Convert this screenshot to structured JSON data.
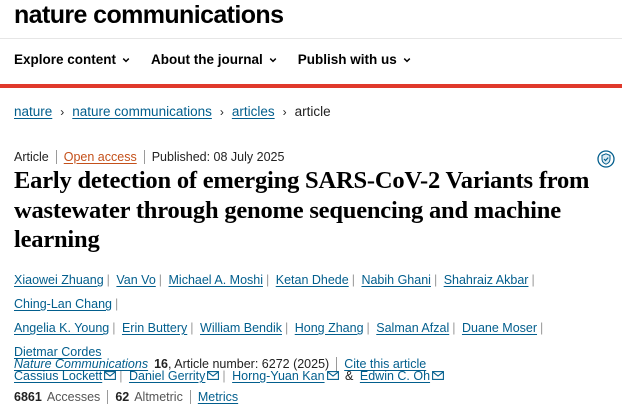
{
  "header": {
    "brand": "nature communications"
  },
  "nav": [
    {
      "label": "Explore content"
    },
    {
      "label": "About the journal"
    },
    {
      "label": "Publish with us"
    }
  ],
  "breadcrumb": {
    "items": [
      "nature",
      "nature communications",
      "articles"
    ],
    "current": "article",
    "separator": "›"
  },
  "article": {
    "type": "Article",
    "access": "Open access",
    "published": "Published: 08 July 2025",
    "title": "Early detection of emerging SARS-CoV-2 Variants from wastewater through genome sequencing and machine learning",
    "authors": [
      "Xiaowei Zhuang",
      "Van Vo",
      "Michael A. Moshi",
      "Ketan Dhede",
      "Nabih Ghani",
      "Shahraiz Akbar",
      "Ching-Lan Chang",
      "Angelia K. Young",
      "Erin Buttery",
      "William Bendik",
      "Hong Zhang",
      "Salman Afzal",
      "Duane Moser",
      "Dietmar Cordes",
      "Cassius Lockett",
      "Daniel Gerrity",
      "Horng-Yuan Kan",
      "Edwin C. Oh"
    ],
    "author_conjunction": "&",
    "author_separator": "|",
    "citation": {
      "journal": "Nature Communications",
      "volume": "16",
      "article_number": ", Article number: 6272 (2025)",
      "cite_link": "Cite this article"
    },
    "metrics": {
      "accesses_count": "6861",
      "accesses_label": "Accesses",
      "altmetric_count": "62",
      "altmetric_label": "Altmetric",
      "metrics_link": "Metrics"
    }
  },
  "icons": {
    "nav_dropdown": "chevron-down-icon",
    "email": "envelope-icon",
    "bookmark": "shield-badge-icon"
  },
  "colors": {
    "link": "#025e8d",
    "open_access": "#c4501a",
    "accent_bar": "#e0392b"
  }
}
